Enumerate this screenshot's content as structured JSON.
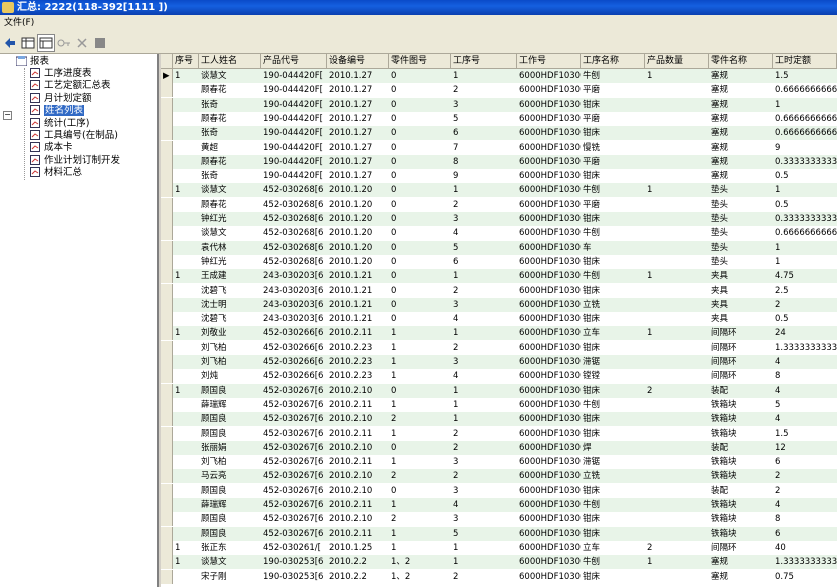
{
  "window": {
    "title": "汇总:   2222(118-392[1111  ])"
  },
  "menu": {
    "file": "文件(F)"
  },
  "tree": {
    "root": "报表",
    "items": [
      "工序进度表",
      "工艺定额汇总表",
      "月计划定额",
      "姓名列表",
      "统计(工序)",
      "工具编号(在制品)",
      "成本卡",
      "作业计划订制开发",
      "材料汇总"
    ],
    "selected_index": 3
  },
  "columns": [
    "序号",
    "工人姓名",
    "产品代号",
    "设备编号",
    "零件图号",
    "工序号",
    "工作号",
    "工序名称",
    "产品数量",
    "零件名称",
    "工时定额"
  ],
  "rows": [
    [
      "1",
      "谈慧文",
      "190-044420F[",
      "2010.1.27",
      "0",
      "1",
      "6000HDF10300",
      "牛刨",
      "1",
      "塞规",
      "1.5"
    ],
    [
      "",
      "顾春花",
      "190-044420F[",
      "2010.1.27",
      "0",
      "2",
      "6000HDF10300",
      "平磨",
      "",
      "塞规",
      "0.6666666666"
    ],
    [
      "",
      "张奇",
      "190-044420F[",
      "2010.1.27",
      "0",
      "3",
      "6000HDF10300",
      "钳床",
      "",
      "塞规",
      "1"
    ],
    [
      "",
      "顾春花",
      "190-044420F[",
      "2010.1.27",
      "0",
      "5",
      "6000HDF10300",
      "平磨",
      "",
      "塞规",
      "0.6666666666"
    ],
    [
      "",
      "张奇",
      "190-044420F[",
      "2010.1.27",
      "0",
      "6",
      "6000HDF10300",
      "钳床",
      "",
      "塞规",
      "0.6666666666"
    ],
    [
      "",
      "黄超",
      "190-044420F[",
      "2010.1.27",
      "0",
      "7",
      "6000HDF10300",
      "慢铣",
      "",
      "塞规",
      "9"
    ],
    [
      "",
      "顾春花",
      "190-044420F[",
      "2010.1.27",
      "0",
      "8",
      "6000HDF10300",
      "平磨",
      "",
      "塞规",
      "0.3333333333"
    ],
    [
      "",
      "张奇",
      "190-044420F[",
      "2010.1.27",
      "0",
      "9",
      "6000HDF10300",
      "钳床",
      "",
      "塞规",
      "0.5"
    ],
    [
      "1",
      "谈慧文",
      "452-030268[6",
      "2010.1.20",
      "0",
      "1",
      "6000HDF10300",
      "牛刨",
      "1",
      "垫头",
      "1"
    ],
    [
      "",
      "顾春花",
      "452-030268[6",
      "2010.1.20",
      "0",
      "2",
      "6000HDF10300",
      "平磨",
      "",
      "垫头",
      "0.5"
    ],
    [
      "",
      "钟红光",
      "452-030268[6",
      "2010.1.20",
      "0",
      "3",
      "6000HDF10300",
      "钳床",
      "",
      "垫头",
      "0.3333333333"
    ],
    [
      "",
      "谈慧文",
      "452-030268[6",
      "2010.1.20",
      "0",
      "4",
      "6000HDF10300",
      "牛刨",
      "",
      "垫头",
      "0.6666666666"
    ],
    [
      "",
      "袁代林",
      "452-030268[6",
      "2010.1.20",
      "0",
      "5",
      "6000HDF10300",
      "车",
      "",
      "垫头",
      "1"
    ],
    [
      "",
      "钟红光",
      "452-030268[6",
      "2010.1.20",
      "0",
      "6",
      "6000HDF10300",
      "钳床",
      "",
      "垫头",
      "1"
    ],
    [
      "1",
      "王成建",
      "243-030203[6",
      "2010.1.21",
      "0",
      "1",
      "6000HDF10300",
      "牛刨",
      "1",
      "夹具",
      "4.75"
    ],
    [
      "",
      "沈碧飞",
      "243-030203[6",
      "2010.1.21",
      "0",
      "2",
      "6000HDF10300",
      "钳床",
      "",
      "夹具",
      "2.5"
    ],
    [
      "",
      "沈士明",
      "243-030203[6",
      "2010.1.21",
      "0",
      "3",
      "6000HDF10300",
      "立铣",
      "",
      "夹具",
      "2"
    ],
    [
      "",
      "沈碧飞",
      "243-030203[6",
      "2010.1.21",
      "0",
      "4",
      "6000HDF10300",
      "钳床",
      "",
      "夹具",
      "0.5"
    ],
    [
      "1",
      "刘敬业",
      "452-030266[6",
      "2010.2.11",
      "1",
      "1",
      "6000HDF10300",
      "立车",
      "1",
      "间隔环",
      "24"
    ],
    [
      "",
      "刘飞柏",
      "452-030266[6",
      "2010.2.23",
      "1",
      "2",
      "6000HDF10300",
      "钳床",
      "",
      "间隔环",
      "1.3333333333"
    ],
    [
      "",
      "刘飞柏",
      "452-030266[6",
      "2010.2.23",
      "1",
      "3",
      "6000HDF10300",
      "滞锯",
      "",
      "间隔环",
      "4"
    ],
    [
      "",
      "刘炖",
      "452-030266[6",
      "2010.2.23",
      "1",
      "4",
      "6000HDF10300",
      "镗镗",
      "",
      "间隔环",
      "8"
    ],
    [
      "1",
      "顾国良",
      "452-030267[6",
      "2010.2.10",
      "0",
      "1",
      "6000HDF10300",
      "钳床",
      "2",
      "装配",
      "4"
    ],
    [
      "",
      "薛瑞辉",
      "452-030267[6",
      "2010.2.11",
      "1",
      "1",
      "6000HDF10300",
      "牛刨",
      "",
      "铁箱块",
      "5"
    ],
    [
      "",
      "顾国良",
      "452-030267[6",
      "2010.2.10",
      "2",
      "1",
      "6000HDF10300",
      "钳床",
      "",
      "铁箱块",
      "4"
    ],
    [
      "",
      "顾国良",
      "452-030267[6",
      "2010.2.11",
      "1",
      "2",
      "6000HDF10300",
      "钳床",
      "",
      "铁箱块",
      "1.5"
    ],
    [
      "",
      "张丽娟",
      "452-030267[6",
      "2010.2.10",
      "0",
      "2",
      "6000HDF10300",
      "焊",
      "",
      "装配",
      "12"
    ],
    [
      "",
      "刘飞柏",
      "452-030267[6",
      "2010.2.11",
      "1",
      "3",
      "6000HDF10300",
      "滞锯",
      "",
      "铁箱块",
      "6"
    ],
    [
      "",
      "马云亮",
      "452-030267[6",
      "2010.2.10",
      "2",
      "2",
      "6000HDF10300",
      "立铣",
      "",
      "铁箱块",
      "2"
    ],
    [
      "",
      "顾国良",
      "452-030267[6",
      "2010.2.10",
      "0",
      "3",
      "6000HDF10300",
      "钳床",
      "",
      "装配",
      "2"
    ],
    [
      "",
      "薛瑞辉",
      "452-030267[6",
      "2010.2.11",
      "1",
      "4",
      "6000HDF10300",
      "牛刨",
      "",
      "铁箱块",
      "4"
    ],
    [
      "",
      "顾国良",
      "452-030267[6",
      "2010.2.10",
      "2",
      "3",
      "6000HDF10300",
      "钳床",
      "",
      "铁箱块",
      "8"
    ],
    [
      "",
      "顾国良",
      "452-030267[6",
      "2010.2.11",
      "1",
      "5",
      "6000HDF10300",
      "钳床",
      "",
      "铁箱块",
      "6"
    ],
    [
      "1",
      "张正东",
      "452-030261/[",
      "2010.1.25",
      "1",
      "1",
      "6000HDF10300",
      "立车",
      "2",
      "间隔环",
      "40"
    ],
    [
      "1",
      "谈慧文",
      "190-030253[6",
      "2010.2.2",
      "1、2",
      "1",
      "6000HDF10300",
      "牛刨",
      "1",
      "塞规",
      "1.3333333333"
    ],
    [
      "",
      "宋子刚",
      "190-030253[6",
      "2010.2.2",
      "1、2",
      "2",
      "6000HDF10300",
      "钳床",
      "",
      "塞规",
      "0.75"
    ]
  ]
}
